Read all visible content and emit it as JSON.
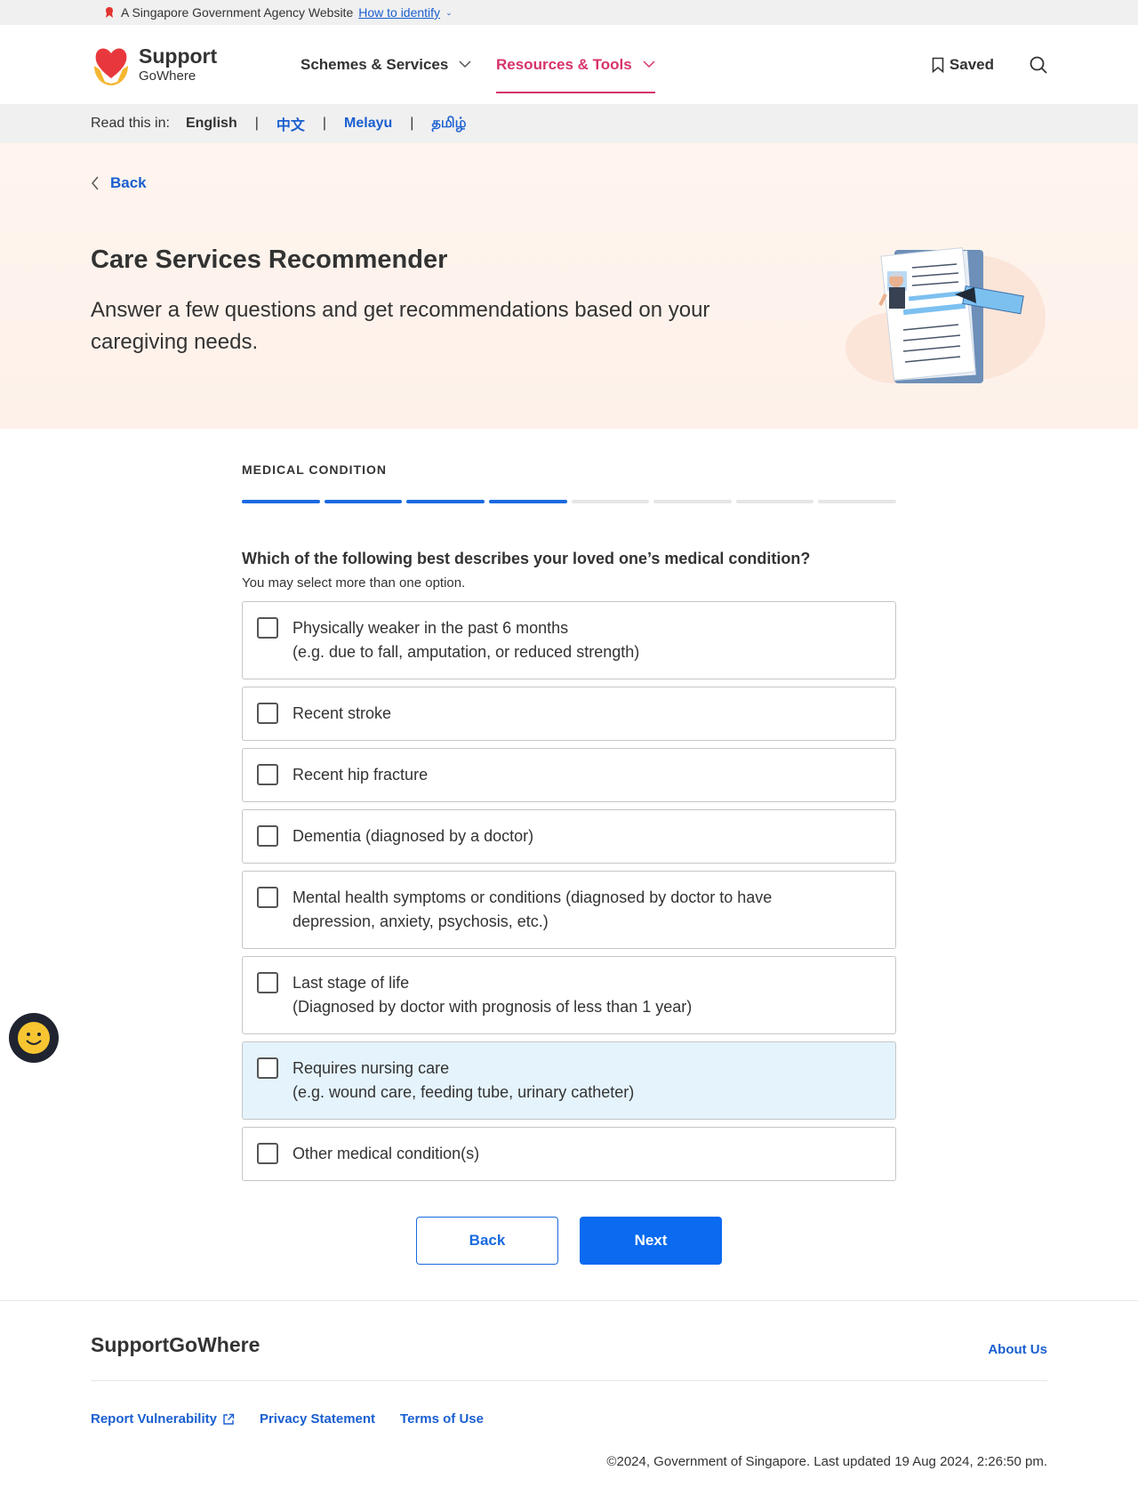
{
  "masthead": {
    "text": "A Singapore Government Agency Website",
    "link": "How to identify"
  },
  "header": {
    "logo_line1": "Support",
    "logo_line2": "GoWhere",
    "nav": [
      {
        "label": "Schemes & Services"
      },
      {
        "label": "Resources & Tools"
      }
    ],
    "saved": "Saved"
  },
  "langbar": {
    "label": "Read this in:",
    "english": "English",
    "chinese": "中文",
    "malay": "Melayu",
    "tamil": "தமிழ்"
  },
  "hero": {
    "back": "Back",
    "title": "Care Services Recommender",
    "subtitle": "Answer a few questions and get recommendations based on your caregiving needs."
  },
  "form": {
    "step_label": "MEDICAL CONDITION",
    "progress": {
      "completed": 4,
      "total": 8
    },
    "question": "Which of the following best describes your loved one’s medical condition?",
    "hint": "You may select more than one option.",
    "options": [
      {
        "line1": "Physically weaker in the past 6 months",
        "line2": "(e.g. due to fall, amputation, or reduced strength)"
      },
      {
        "line1": "Recent stroke",
        "line2": ""
      },
      {
        "line1": "Recent hip fracture",
        "line2": ""
      },
      {
        "line1": "Dementia (diagnosed by a doctor)",
        "line2": ""
      },
      {
        "line1": "Mental health symptoms or conditions (diagnosed by doctor to have",
        "line2": "depression, anxiety, psychosis, etc.)"
      },
      {
        "line1": "Last stage of life",
        "line2": "(Diagnosed by doctor with prognosis of less than 1 year)"
      },
      {
        "line1": "Requires nursing care",
        "line2": "(e.g. wound care, feeding tube, urinary catheter)"
      },
      {
        "line1": "Other medical condition(s)",
        "line2": ""
      }
    ],
    "back_button": "Back",
    "next_button": "Next"
  },
  "footer": {
    "brand": "SupportGoWhere",
    "about": "About Us",
    "links": [
      "Report Vulnerability",
      "Privacy Statement",
      "Terms of Use"
    ],
    "copyright": "©2024, Government of Singapore. Last updated 19 Aug 2024, 2:26:50 pm."
  },
  "colors": {
    "accent": "#0a6af0",
    "nav_active": "#d6336c",
    "highlight_bg": "#e4f3fc"
  }
}
